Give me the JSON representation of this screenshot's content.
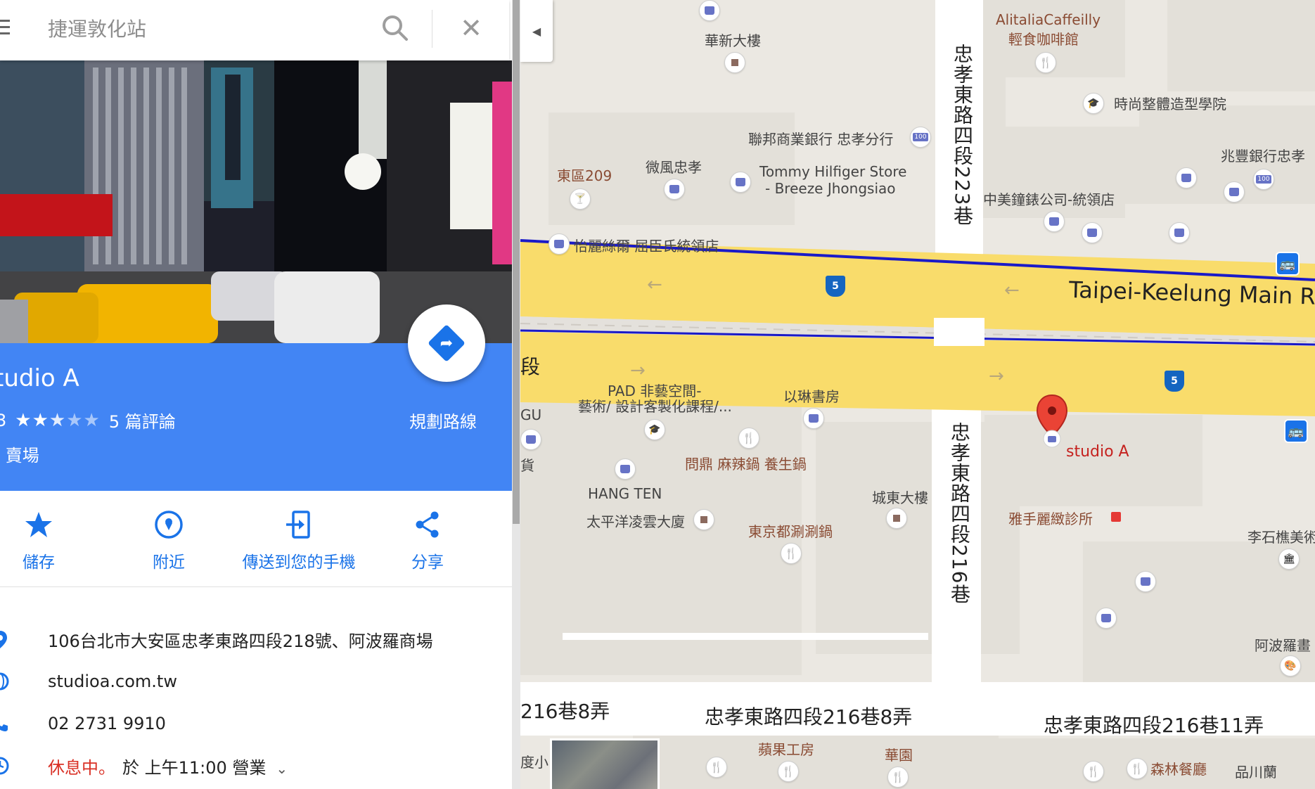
{
  "search": {
    "placeholder": "捷運敦化站"
  },
  "place": {
    "name": "studio A",
    "name_partial": "tudio A",
    "rating": "3",
    "rating_fraction": 0.6,
    "reviews": "5 篇評論",
    "category": "賣場",
    "route_label": "規劃路線"
  },
  "actions": [
    {
      "label": "儲存",
      "icon": "star-icon"
    },
    {
      "label": "附近",
      "icon": "nearby-icon"
    },
    {
      "label": "傳送到您的手機",
      "icon": "send-to-phone-icon"
    },
    {
      "label": "分享",
      "icon": "share-icon"
    }
  ],
  "info": {
    "address": "106台北市大安區忠孝東路四段218號、阿波羅商場",
    "website": "studioa.com.tw",
    "phone": "02 2731 9910",
    "status_closed": "休息中",
    "status_dot": "。",
    "hours_text": "於 上午11:00 營業"
  },
  "map": {
    "main_road": "Taipei-Keelung Main Ro",
    "main_road_partial_left": "段",
    "route_shield": "5",
    "vertical_road_top": "忠孝東路四段223巷",
    "vertical_road_bottom": "忠孝東路四段216巷",
    "road_216_8_left": "216巷8弄",
    "road_216_8": "忠孝東路四段216巷8弄",
    "road_216_11": "忠孝東路四段216巷11弄",
    "labels": {
      "huaxin": "華新大樓",
      "alitalia_1": "AlitaliaCaffeilly",
      "alitalia_2": "輕食咖啡館",
      "fashion_school": "時尚整體造型學院",
      "union_bank": "聯邦商業銀行 忠孝分行",
      "weifeng": "微風忠孝",
      "tommy_1": "Tommy Hilfiger Store",
      "tommy_2": "- Breeze Jhongsiao",
      "east209": "東區209",
      "zhaofeng": "兆豐銀行忠孝",
      "sino_clock": "中美鐘錶公司-統領店",
      "yili": "怡麗絲爾 屈臣氏統領店",
      "pad_1": "PAD 非藝空間-",
      "pad_2": "藝術/ 設計客製化課程/...",
      "yilin": "以琳書房",
      "gu": "GU",
      "huo": "貨",
      "wending": "問鼎 麻辣鍋 養生鍋",
      "hangten": "HANG TEN",
      "pacific": "太平洋凌雲大廈",
      "tokyo": "東京都涮涮鍋",
      "chengdong": "城東大樓",
      "studio_a": "studio A",
      "clinic": "雅手麗緻診所",
      "lishiqiao": "李石樵美術",
      "apollo": "阿波羅畫",
      "apple": "蘋果工房",
      "huayuan": "華園",
      "senlin": "森林餐廳",
      "pinchuan": "品川蘭",
      "xiaosmall": "度小"
    }
  }
}
